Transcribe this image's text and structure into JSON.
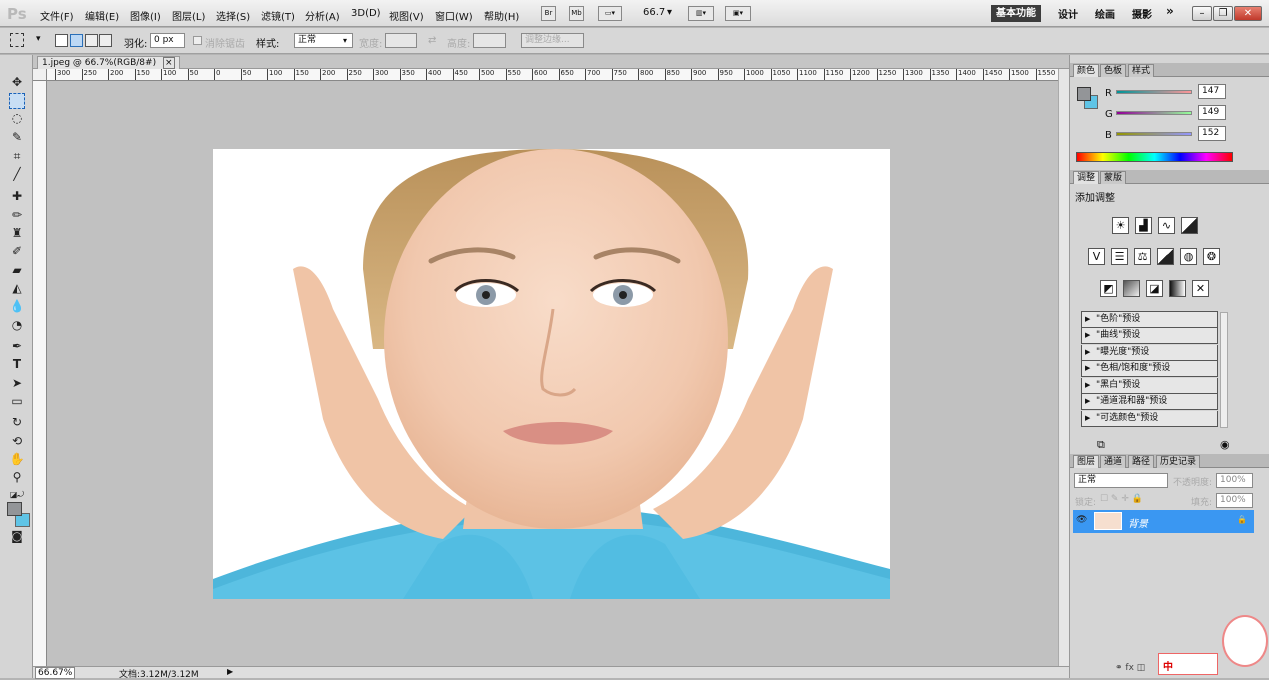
{
  "app": {
    "logo": "Ps"
  },
  "menus": [
    "文件(F)",
    "编辑(E)",
    "图像(I)",
    "图层(L)",
    "选择(S)",
    "滤镜(T)",
    "分析(A)",
    "3D(D)",
    "视图(V)",
    "窗口(W)",
    "帮助(H)"
  ],
  "appbar": {
    "br_label": "Br",
    "mb_label": "Mb",
    "zoom_value": "66.7"
  },
  "workspaces": {
    "active": "基本功能",
    "items": [
      "设计",
      "绘画",
      "摄影"
    ],
    "more": "»"
  },
  "options": {
    "feather_label": "羽化:",
    "feather_value": "0 px",
    "antialias_label": "消除锯齿",
    "style_label": "样式:",
    "style_value": "正常",
    "width_label": "宽度:",
    "height_label": "高度:",
    "refine_edge_label": "调整边缘..."
  },
  "document": {
    "tab_title": "1.jpeg @ 66.7%(RGB/8#)",
    "close_glyph": "×",
    "zoom_percent": "66.67%",
    "doc_size": "文档:3.12M/3.12M"
  },
  "ruler": {
    "h_ticks": [
      "300",
      "250",
      "200",
      "150",
      "100",
      "50",
      "0",
      "50",
      "100",
      "150",
      "200",
      "250",
      "300",
      "350",
      "400",
      "450",
      "500",
      "550",
      "600",
      "650",
      "700",
      "750",
      "800",
      "850",
      "900",
      "950",
      "1000",
      "1050",
      "1100",
      "1150",
      "1200",
      "1250",
      "1300",
      "1350",
      "1400",
      "1450",
      "1500",
      "1550"
    ]
  },
  "color_panel": {
    "tabs": [
      "颜色",
      "色板",
      "样式"
    ],
    "r_label": "R",
    "g_label": "G",
    "b_label": "B",
    "r": "147",
    "g": "149",
    "b": "152"
  },
  "adjust_panel": {
    "tabs": [
      "调整",
      "蒙版"
    ],
    "title": "添加调整",
    "presets": [
      "\"色阶\"预设",
      "\"曲线\"预设",
      "\"曝光度\"预设",
      "\"色相/饱和度\"预设",
      "\"黑白\"预设",
      "\"通道混和器\"预设",
      "\"可选颜色\"预设"
    ]
  },
  "layers_panel": {
    "tabs": [
      "图层",
      "通道",
      "路径",
      "历史记录"
    ],
    "blend_mode": "正常",
    "opacity_label": "不透明度:",
    "opacity": "100%",
    "lock_label": "锁定:",
    "fill_label": "填充:",
    "fill": "100%",
    "layer_name": "背景"
  },
  "ime": {
    "label": "中"
  },
  "colors": {
    "selection_blue": "#3a97f2",
    "foreground": "#939598",
    "background": "#5fc4e6"
  }
}
